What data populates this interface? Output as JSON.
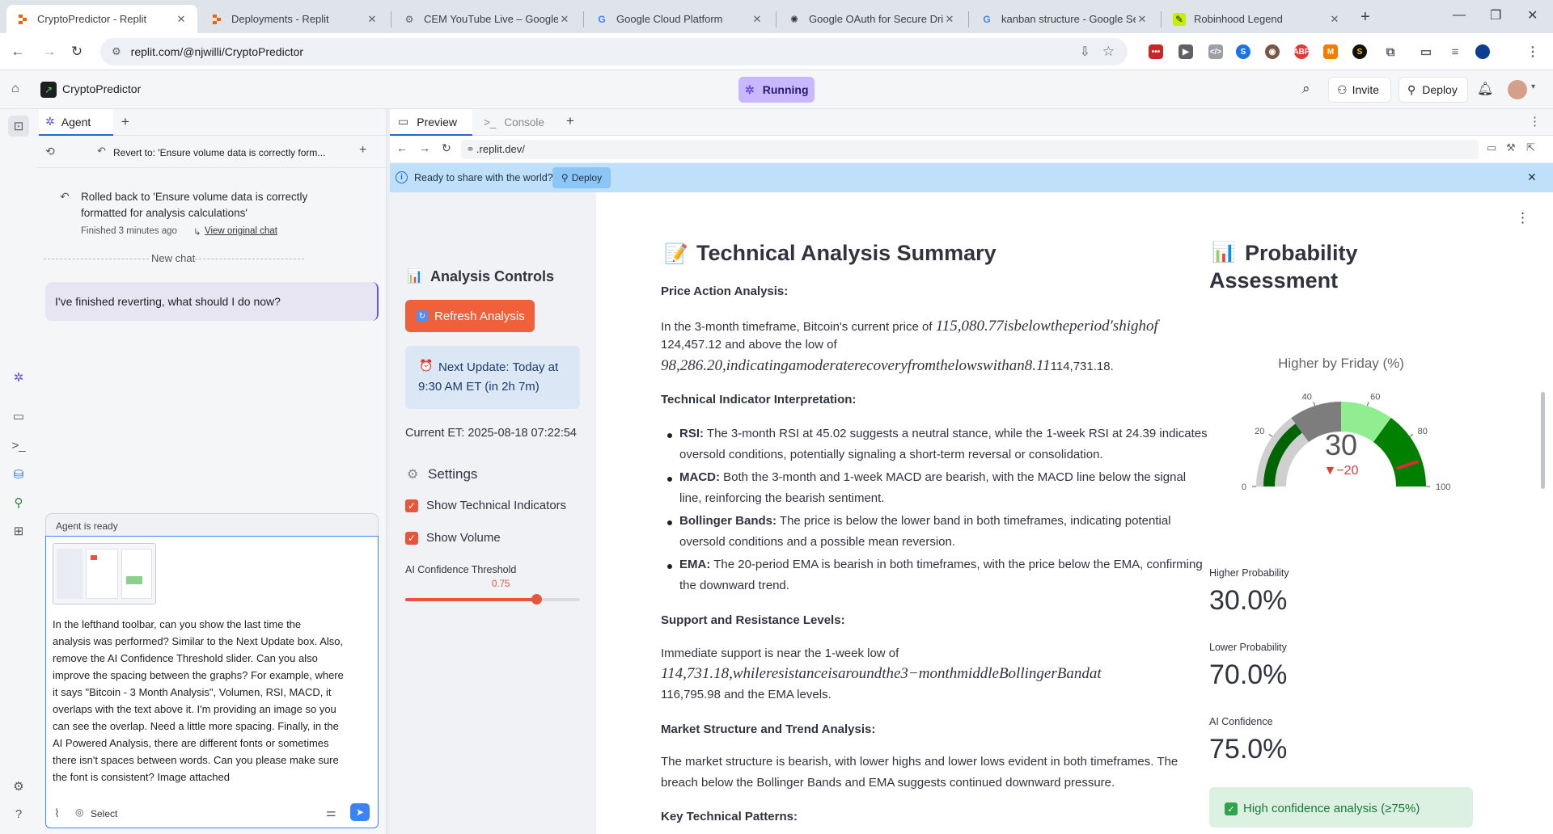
{
  "browser": {
    "tabs": [
      {
        "title": "CryptoPredictor - Replit",
        "icon": "replit-icon",
        "active": true
      },
      {
        "title": "Deployments - Replit",
        "icon": "replit-icon"
      },
      {
        "title": "CEM YouTube Live – Google Cl",
        "icon": "google-cloud-icon"
      },
      {
        "title": "Google Cloud Platform",
        "icon": "google-icon"
      },
      {
        "title": "Google OAuth for Secure Drive",
        "icon": "openai-icon"
      },
      {
        "title": "kanban structure - Google Sear",
        "icon": "google-icon"
      },
      {
        "title": "Robinhood Legend",
        "icon": "robinhood-icon"
      }
    ],
    "url": "replit.com/@njwilli/CryptoPredictor"
  },
  "replit": {
    "project_name": "CryptoPredictor",
    "status": "Running",
    "invite_label": "Invite",
    "deploy_label": "Deploy"
  },
  "agent": {
    "tab_label": "Agent",
    "revert_label": "Revert to: 'Ensure volume data is correctly form...",
    "rollback_line1": "Rolled back to 'Ensure volume data is correctly",
    "rollback_line2": "formatted for analysis calculations'",
    "finished": "Finished 3 minutes ago",
    "view_chat": "View original chat",
    "new_chat": "New chat",
    "prompt_message": "I've finished reverting, what should I do now?",
    "ready": "Agent is ready",
    "input_lines": [
      "In the lefthand toolbar, can you show the last time the",
      "analysis was performed? Similar to the Next Update box. Also,",
      "remove the AI Confidence Threshold slider. Can you also",
      "improve the spacing between the graphs? For example, where",
      "it says \"Bitcoin - 3 Month Analysis\", Volumen, RSI, MACD, it",
      "overlaps with the text above it. I'm providing an image so you",
      "can see the overlap. Need a little more spacing. Finally, in the",
      "AI Powered Analysis, there are different fonts or sometimes",
      "there isn't spaces between words.  Can you please make sure",
      "the font is consistent? Image attached"
    ],
    "select_label": "Select"
  },
  "preview": {
    "tab_preview": "Preview",
    "tab_console": "Console",
    "url": ".replit.dev/",
    "banner_text": "Ready to share with the world?",
    "banner_deploy": "Deploy"
  },
  "sidebar": {
    "controls_title": "Analysis Controls",
    "refresh_label": "Refresh Analysis",
    "next_update_line1": "Next Update: Today at",
    "next_update_line2": "9:30 AM ET (in 2h 7m)",
    "current_et": "Current ET: 2025-08-18 07:22:54",
    "settings_title": "Settings",
    "show_indicators": "Show Technical Indicators",
    "show_volume": "Show Volume",
    "threshold_label": "AI Confidence Threshold",
    "threshold_value": "0.75",
    "threshold_fraction": 0.75
  },
  "summary": {
    "title": "Technical Analysis Summary",
    "h_price": "Price Action Analysis:",
    "price_p1_a": "In the 3-month timeframe, Bitcoin's current price of",
    "price_p1_math": "115,080.77isbelowtheperiod′shighof",
    "price_p1_b": "124,457.12 and above the low of",
    "price_p2_math": "98,286.20,indicatingamoderaterecoveryfromthelowswithan8.11",
    "price_p2_b": "114,731.18.",
    "h_indicators": "Technical Indicator Interpretation:",
    "rsi_label": "RSI:",
    "rsi_1": "The 3-month RSI at 45.02 suggests a neutral stance, while the 1-week RSI at 24.39 indicates",
    "rsi_2": "oversold conditions, potentially signaling a short-term reversal or consolidation.",
    "macd_label": "MACD:",
    "macd_1": "Both the 3-month and 1-week MACD are bearish, with the MACD line below the signal",
    "macd_2": "line, reinforcing the bearish sentiment.",
    "bb_label": "Bollinger Bands:",
    "bb_1": "The price is below the lower band in both timeframes, indicating potential",
    "bb_2": "oversold conditions and a possible mean reversion.",
    "ema_label": "EMA:",
    "ema_1": "The 20-period EMA is bearish in both timeframes, with the price below the EMA, confirming",
    "ema_2": "the downward trend.",
    "h_support": "Support and Resistance Levels:",
    "support_1": "Immediate support is near the 1-week low of",
    "support_math": "114,731.18,whileresistanceisaroundthe3−monthmiddleBollingerBandat",
    "support_2": "116,795.98 and the EMA levels.",
    "h_market": "Market Structure and Trend Analysis:",
    "market_1": "The market structure is bearish, with lower highs and lower lows evident in both timeframes. The",
    "market_2": "breach below the Bollinger Bands and EMA suggests continued downward pressure.",
    "h_patterns": "Key Technical Patterns:"
  },
  "probability": {
    "title_1": "Probability",
    "title_2": "Assessment",
    "gauge_title": "Higher by Friday (%)",
    "gauge_value": "30",
    "gauge_delta": "▼−20",
    "value": 30,
    "reference": 50,
    "ticks": [
      "0",
      "20",
      "40",
      "60",
      "80",
      "100"
    ],
    "higher_label": "Higher Probability",
    "higher_value": "30.0%",
    "lower_label": "Lower Probability",
    "lower_value": "70.0%",
    "ai_label": "AI Confidence",
    "ai_value": "75.0%",
    "high_conf": "High confidence analysis (≥75%)"
  }
}
